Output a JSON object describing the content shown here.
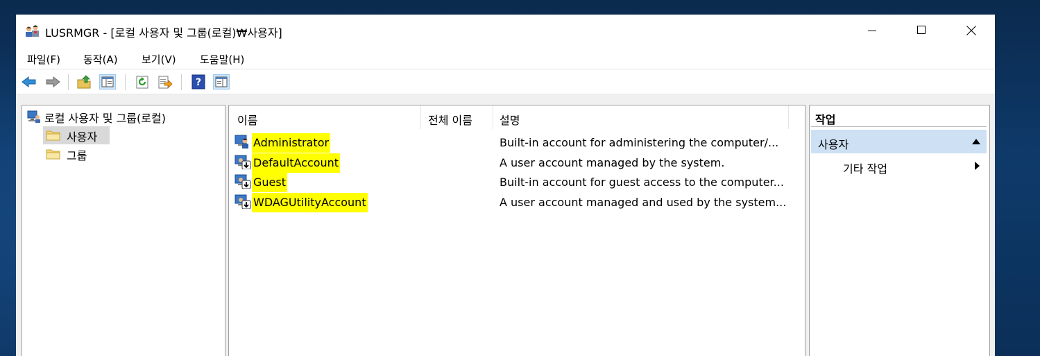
{
  "window": {
    "title": "LUSRMGR - [로컬 사용자 및 그룹(로컬)₩사용자]",
    "app_icon": "users-mmc-icon",
    "controls": {
      "minimize": "minimize-icon",
      "maximize": "maximize-icon",
      "close": "close-icon"
    }
  },
  "menu": [
    "파일(F)",
    "동작(A)",
    "보기(V)",
    "도움말(H)"
  ],
  "toolbar": {
    "buttons": [
      "back-icon",
      "forward-icon",
      "up-folder-icon",
      "show-hide-tree-icon",
      "refresh-icon",
      "export-list-icon",
      "help-icon",
      "show-hide-action-pane-icon"
    ]
  },
  "tree": {
    "root": "로컬 사용자 및 그룹(로컬)",
    "children": [
      "사용자",
      "그룹"
    ],
    "selected": "사용자"
  },
  "list": {
    "columns": [
      "이름",
      "전체 이름",
      "설명"
    ],
    "rows": [
      {
        "name": "Administrator",
        "full_name": "",
        "description": "Built-in account for administering the computer/..."
      },
      {
        "name": "DefaultAccount",
        "full_name": "",
        "description": "A user account managed by the system."
      },
      {
        "name": "Guest",
        "full_name": "",
        "description": "Built-in account for guest access to the computer..."
      },
      {
        "name": "WDAGUtilityAccount",
        "full_name": "",
        "description": "A user account managed and used by the system..."
      }
    ],
    "highlight_color": "#ffff00"
  },
  "actions": {
    "header": "작업",
    "section": "사용자",
    "items": [
      "기타 작업"
    ],
    "section_color": "#cde0f4"
  }
}
